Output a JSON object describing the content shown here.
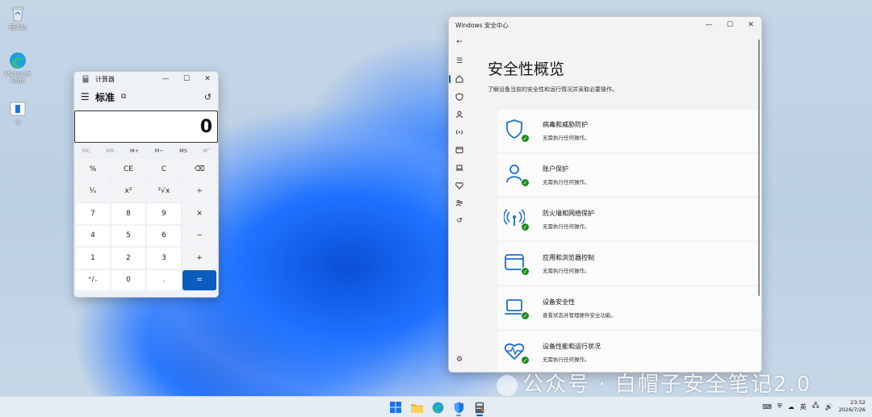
{
  "desktop": {
    "icons": [
      {
        "label": "回收站",
        "icon": "recycle-bin-icon"
      },
      {
        "label": "Microsoft Edge",
        "icon": "edge-icon"
      },
      {
        "label": "Ⓢ",
        "icon": "document-icon"
      }
    ]
  },
  "calculator": {
    "title": "计算器",
    "mode": "标准",
    "display": "0",
    "memory": [
      "MC",
      "MR",
      "M+",
      "M−",
      "MS",
      "M˅"
    ],
    "memory_enabled": [
      false,
      false,
      true,
      true,
      true,
      false
    ],
    "keys": [
      {
        "label": "%",
        "type": "op"
      },
      {
        "label": "CE",
        "type": "op"
      },
      {
        "label": "C",
        "type": "op"
      },
      {
        "label": "⌫",
        "type": "op"
      },
      {
        "label": "¹⁄ₓ",
        "type": "op"
      },
      {
        "label": "x²",
        "type": "op"
      },
      {
        "label": "²√x",
        "type": "op"
      },
      {
        "label": "÷",
        "type": "op"
      },
      {
        "label": "7",
        "type": "num"
      },
      {
        "label": "8",
        "type": "num"
      },
      {
        "label": "9",
        "type": "num"
      },
      {
        "label": "×",
        "type": "op"
      },
      {
        "label": "4",
        "type": "num"
      },
      {
        "label": "5",
        "type": "num"
      },
      {
        "label": "6",
        "type": "num"
      },
      {
        "label": "−",
        "type": "op"
      },
      {
        "label": "1",
        "type": "num"
      },
      {
        "label": "2",
        "type": "num"
      },
      {
        "label": "3",
        "type": "num"
      },
      {
        "label": "+",
        "type": "op"
      },
      {
        "label": "⁺/₋",
        "type": "num"
      },
      {
        "label": "0",
        "type": "num"
      },
      {
        "label": ".",
        "type": "num"
      },
      {
        "label": "=",
        "type": "eq"
      }
    ]
  },
  "security": {
    "window_title": "Windows 安全中心",
    "heading": "安全性概览",
    "subtitle": "了解设备当前的安全性和运行情况并采取必要操作。",
    "cards": [
      {
        "title": "病毒和威胁防护",
        "status": "无需执行任何操作。",
        "icon": "virus-shield-icon"
      },
      {
        "title": "账户保护",
        "status": "无需执行任何操作。",
        "icon": "account-protection-icon"
      },
      {
        "title": "防火墙和网络保护",
        "status": "无需执行任何操作。",
        "icon": "firewall-network-icon"
      },
      {
        "title": "应用和浏览器控制",
        "status": "无需执行任何操作。",
        "icon": "app-browser-icon"
      },
      {
        "title": "设备安全性",
        "status": "查看状态并管理硬件安全功能。",
        "icon": "device-security-icon"
      },
      {
        "title": "设备性能和运行状况",
        "status": "无需执行任何操作。",
        "icon": "device-health-icon"
      }
    ]
  },
  "watermark": "公众号 · 白帽子安全笔记2.0",
  "taskbar": {
    "language": "英",
    "time": "23:52",
    "date": "2026/7/26"
  },
  "colors": {
    "accent": "#0b5cbd",
    "ok_green": "#1e8a1e"
  }
}
